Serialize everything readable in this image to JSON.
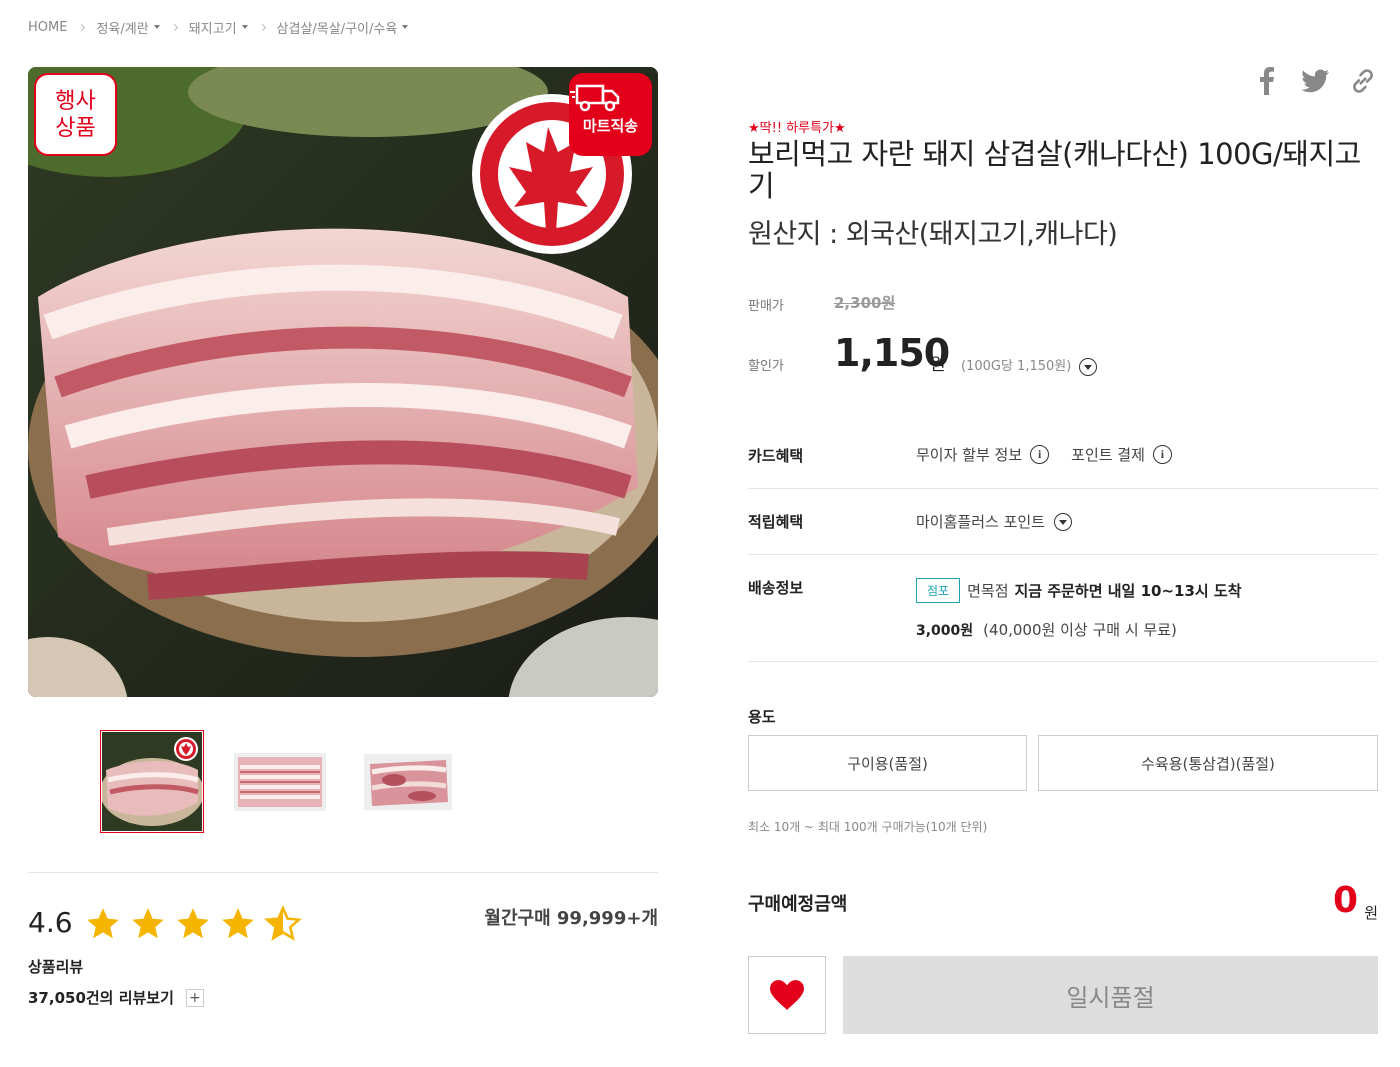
{
  "breadcrumb": {
    "home": "HOME",
    "items": [
      "정육/계란",
      "돼지고기",
      "삼겹살/목살/구이/수육"
    ]
  },
  "image": {
    "event_badge_line1": "행사",
    "event_badge_line2": "상품",
    "delivery_badge": "마트직송"
  },
  "rating": {
    "score": "4.6",
    "stars": 4.6,
    "monthly_sales": "월간구매 99,999+개",
    "review_title": "상품리뷰",
    "review_link": "37,050건의 리뷰보기",
    "plus": "+"
  },
  "product": {
    "promo": "★딱!! 하루특가★",
    "title": "보리먹고 자란 돼지 삼겹살(캐나다산) 100G/돼지고기",
    "origin": "원산지 : 외국산(돼지고기,캐나다)"
  },
  "price": {
    "orig_label": "판매가",
    "orig_value": "2,300원",
    "sale_label": "할인가",
    "sale_value": "1,150",
    "sale_unit": "원",
    "unit_price": "(100G당 1,150원)"
  },
  "benefits": {
    "card_label": "카드혜택",
    "card_item1": "무이자 할부 정보",
    "card_item2": "포인트 결제",
    "point_label": "적립혜택",
    "point_value": "마이홈플러스 포인트",
    "delivery_label": "배송정보",
    "store_tag": "점포",
    "store_name": "면목점",
    "delivery_msg": "지금 주문하면 내일 10~13시 도착",
    "shipping_fee": "3,000원",
    "free_note": "(40,000원 이상 구매 시 무료)"
  },
  "options": {
    "label": "용도",
    "opt1": "구이용(품절)",
    "opt2": "수육용(통삼겹)(품절)",
    "limit": "최소 10개 ~ 최대 100개 구매가능(10개 단위)"
  },
  "total": {
    "label": "구매예정금액",
    "amount": "0",
    "unit": "원"
  },
  "actions": {
    "soldout": "일시품절"
  },
  "colors": {
    "accent": "#e2001a",
    "star": "#f5b400",
    "teal": "#1aa3b3"
  }
}
